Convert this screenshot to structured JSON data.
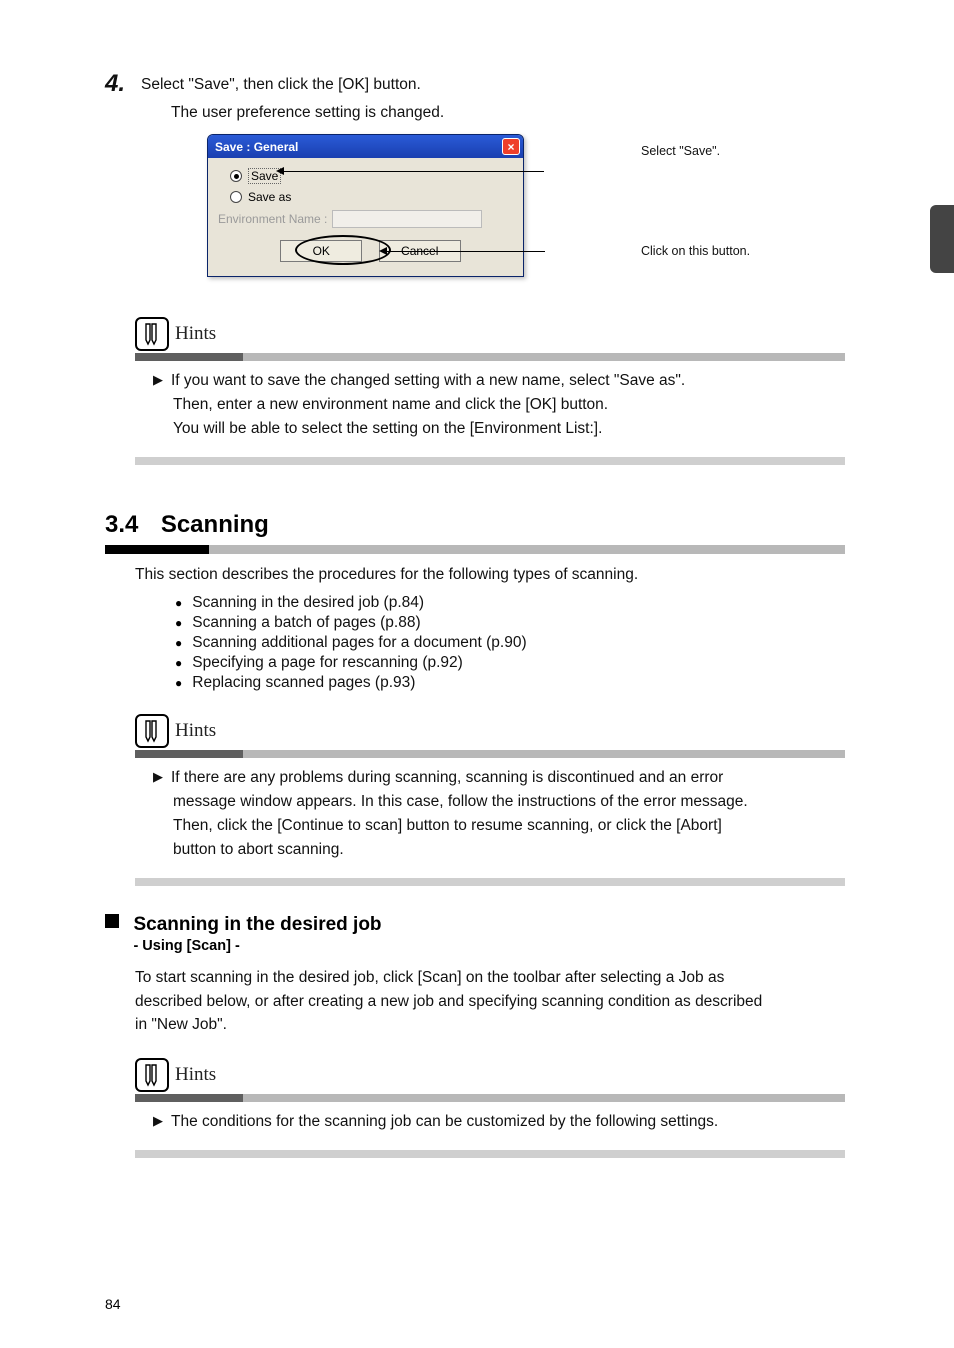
{
  "step4": {
    "num": "4.",
    "line1": "Select \"Save\", then click the [OK] button.",
    "line2": "The user preference setting is changed."
  },
  "dialog": {
    "title": "Save : General",
    "radio_save": "Save",
    "radio_save_as": "Save as",
    "env_label": "Environment Name :",
    "ok": "OK",
    "cancel": "Cancel"
  },
  "callout1": "Select \"Save\".",
  "callout2": "Click on this button.",
  "hints1": {
    "line1": "If you want to save the changed setting with a new name, select \"Save as\".",
    "line2": "Then, enter a new environment name and click the [OK] button.",
    "line3": "You will be able to select the setting on the [Environment List:]."
  },
  "section": {
    "num": "3.4",
    "title": "Scanning"
  },
  "intro": "This section describes the procedures for the following types of scanning.",
  "bullets": [
    {
      "text": "Scanning in the desired job  (",
      "ref": "p.84",
      "close": ")"
    },
    {
      "text": "Scanning a batch of pages  (",
      "ref": "p.88",
      "close": ")"
    },
    {
      "text": "Scanning additional pages for a document  (",
      "ref": "p.90",
      "close": ")"
    },
    {
      "text": "Specifying a page for rescanning  (",
      "ref": "p.92",
      "close": ")"
    },
    {
      "text": "Replacing scanned pages  (",
      "ref": "p.93",
      "close": ")"
    }
  ],
  "hints2": {
    "l1": "If there are any problems during scanning, scanning is discontinued and an error",
    "l2": "message window appears. In this case, follow the instructions of the error message.",
    "l3": "Then, click the [Continue to scan] button to resume scanning, or click the [Abort]",
    "l4": "button to abort scanning."
  },
  "sub": {
    "title": "Scanning in the desired job",
    "subtitle": "- Using [Scan] -"
  },
  "sub_para": {
    "l1": "To start scanning in the desired job, click [Scan] on the toolbar after selecting a Job as",
    "l2": "described below, or after creating a new job and specifying scanning condition as described",
    "l3": "in \"New Job\"."
  },
  "hints3": "The conditions for the scanning job can be customized by the following settings.",
  "page_num": "84"
}
